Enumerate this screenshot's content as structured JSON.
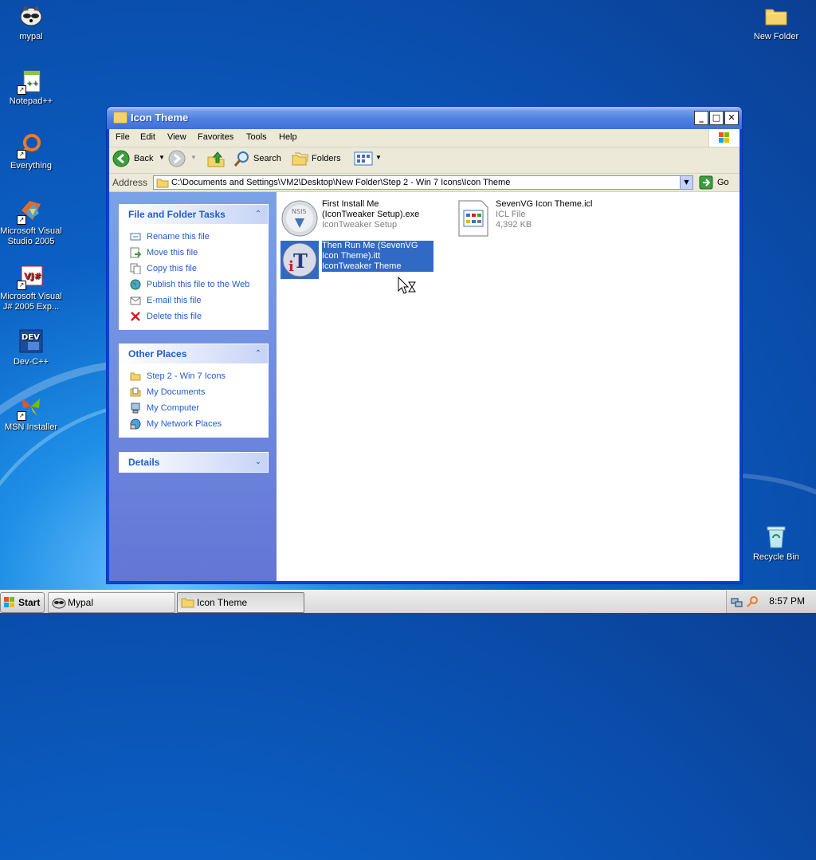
{
  "desktop": {
    "icons": [
      {
        "label": "mypal"
      },
      {
        "label": "Notepad++"
      },
      {
        "label": "Everything"
      },
      {
        "label": "Microsoft Visual Studio 2005"
      },
      {
        "label": "Microsoft Visual J# 2005 Exp..."
      },
      {
        "label": "Dev-C++"
      },
      {
        "label": "MSN Installer"
      },
      {
        "label": "New Folder"
      },
      {
        "label": "Recycle Bin"
      }
    ]
  },
  "window": {
    "title": "Icon Theme",
    "menu": [
      "File",
      "Edit",
      "View",
      "Favorites",
      "Tools",
      "Help"
    ],
    "toolbar": {
      "back": "Back",
      "search": "Search",
      "folders": "Folders"
    },
    "address": {
      "label": "Address",
      "value": "C:\\Documents and Settings\\VM2\\Desktop\\New Folder\\Step 2 - Win 7 Icons\\Icon Theme",
      "go": "Go"
    },
    "panels": {
      "file_tasks": {
        "title": "File and Folder Tasks",
        "items": [
          "Rename this file",
          "Move this file",
          "Copy this file",
          "Publish this file to the Web",
          "E-mail this file",
          "Delete this file"
        ]
      },
      "other_places": {
        "title": "Other Places",
        "items": [
          "Step 2 - Win 7 Icons",
          "My Documents",
          "My Computer",
          "My Network Places"
        ]
      },
      "details": {
        "title": "Details"
      }
    },
    "files": [
      {
        "name": "First Install Me (IconTweaker Setup).exe",
        "type": "IconTweaker Setup",
        "size": ""
      },
      {
        "name": "SevenVG Icon Theme.icl",
        "type": "ICL File",
        "size": "4,392 KB"
      },
      {
        "name": "Then Run Me (SevenVG Icon Theme).itt",
        "type": "IconTweaker Theme",
        "size": ""
      }
    ]
  },
  "taskbar": {
    "start": "Start",
    "tasks": [
      "Mypal",
      "Icon Theme"
    ],
    "clock": "8:57 PM"
  },
  "colors": {
    "titlebar": "#3f6fd8",
    "task_link": "#215dc6",
    "selection": "#316ac5"
  }
}
